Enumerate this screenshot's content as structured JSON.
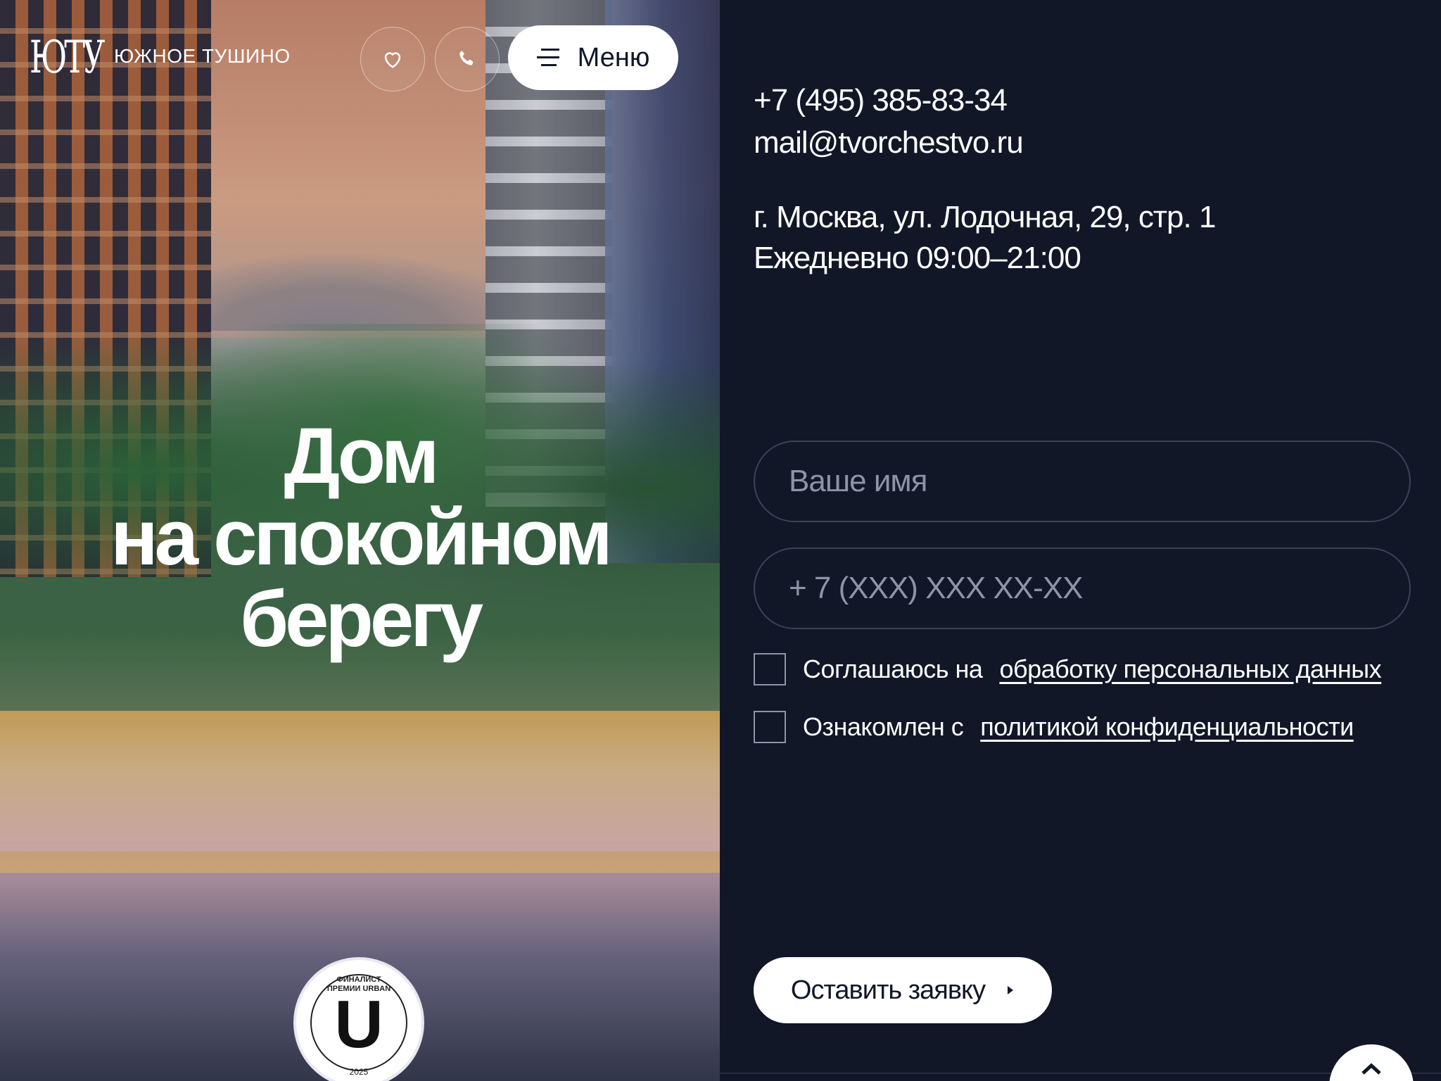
{
  "header": {
    "logo_text": "ЮТУ",
    "brand_name": "ЮЖНОЕ ТУШИНО",
    "menu_label": "Меню",
    "icons": {
      "favorites": "heart-icon",
      "call": "phone-icon",
      "menu": "hamburger-icon"
    }
  },
  "hero": {
    "title_lines": [
      "Дом",
      "на спокойном",
      "берегу"
    ],
    "badge": {
      "top_text": "ФИНАЛИСТ\nПРЕМИИ URBAN",
      "letter": "U",
      "year": "2025"
    }
  },
  "contacts": {
    "phone": "+7 (495) 385-83-34",
    "email": "mail@tvorchestvo.ru",
    "address": "г. Москва, ул. Лодочная, 29, стр. 1",
    "hours": "Ежедневно 09:00–21:00"
  },
  "form": {
    "name_placeholder": "Ваше имя",
    "phone_placeholder": "+ 7 (XXX) XXX XX-XX",
    "consent_prefix": "Соглашаюсь на",
    "consent_link": "обработку персональных данных",
    "policy_prefix": "Ознакомлен с",
    "policy_link": "политикой конфиденциальности",
    "submit_label": "Оставить заявку"
  },
  "colors": {
    "panel_bg": "#111727",
    "accent": "#ffffff",
    "muted": "#8e93a6"
  }
}
